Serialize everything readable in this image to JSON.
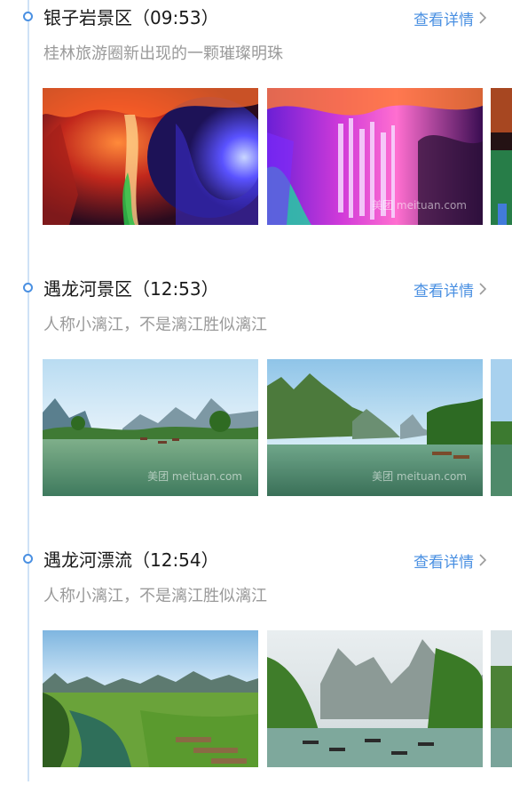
{
  "stops": [
    {
      "title": "银子岩景区（09:53）",
      "link_label": "查看详情",
      "subtitle": "桂林旅游圈新出现的一颗璀璨明珠",
      "photos": [
        {
          "name": "cave-photo-1"
        },
        {
          "name": "cave-photo-2",
          "watermark": "美团 meituan.com"
        },
        {
          "name": "cave-photo-3"
        }
      ]
    },
    {
      "title": "遇龙河景区（12:53）",
      "link_label": "查看详情",
      "subtitle": "人称小漓江，不是漓江胜似漓江",
      "photos": [
        {
          "name": "river-photo-1",
          "watermark": "美团 meituan.com"
        },
        {
          "name": "river-photo-2",
          "watermark": "美团 meituan.com"
        },
        {
          "name": "river-photo-3"
        }
      ]
    },
    {
      "title": "遇龙河漂流（12:54）",
      "link_label": "查看详情",
      "subtitle": "人称小漓江，不是漓江胜似漓江",
      "photos": [
        {
          "name": "rafting-photo-1"
        },
        {
          "name": "rafting-photo-2"
        },
        {
          "name": "rafting-photo-3"
        }
      ]
    }
  ],
  "colors": {
    "accent": "#4a90e2",
    "timeline": "#cfe2f6",
    "title": "#1a1a1a",
    "subtitle": "#9a9a9a"
  },
  "icons": {
    "link": "chevron-right-icon",
    "node": "timeline-dot-icon"
  }
}
